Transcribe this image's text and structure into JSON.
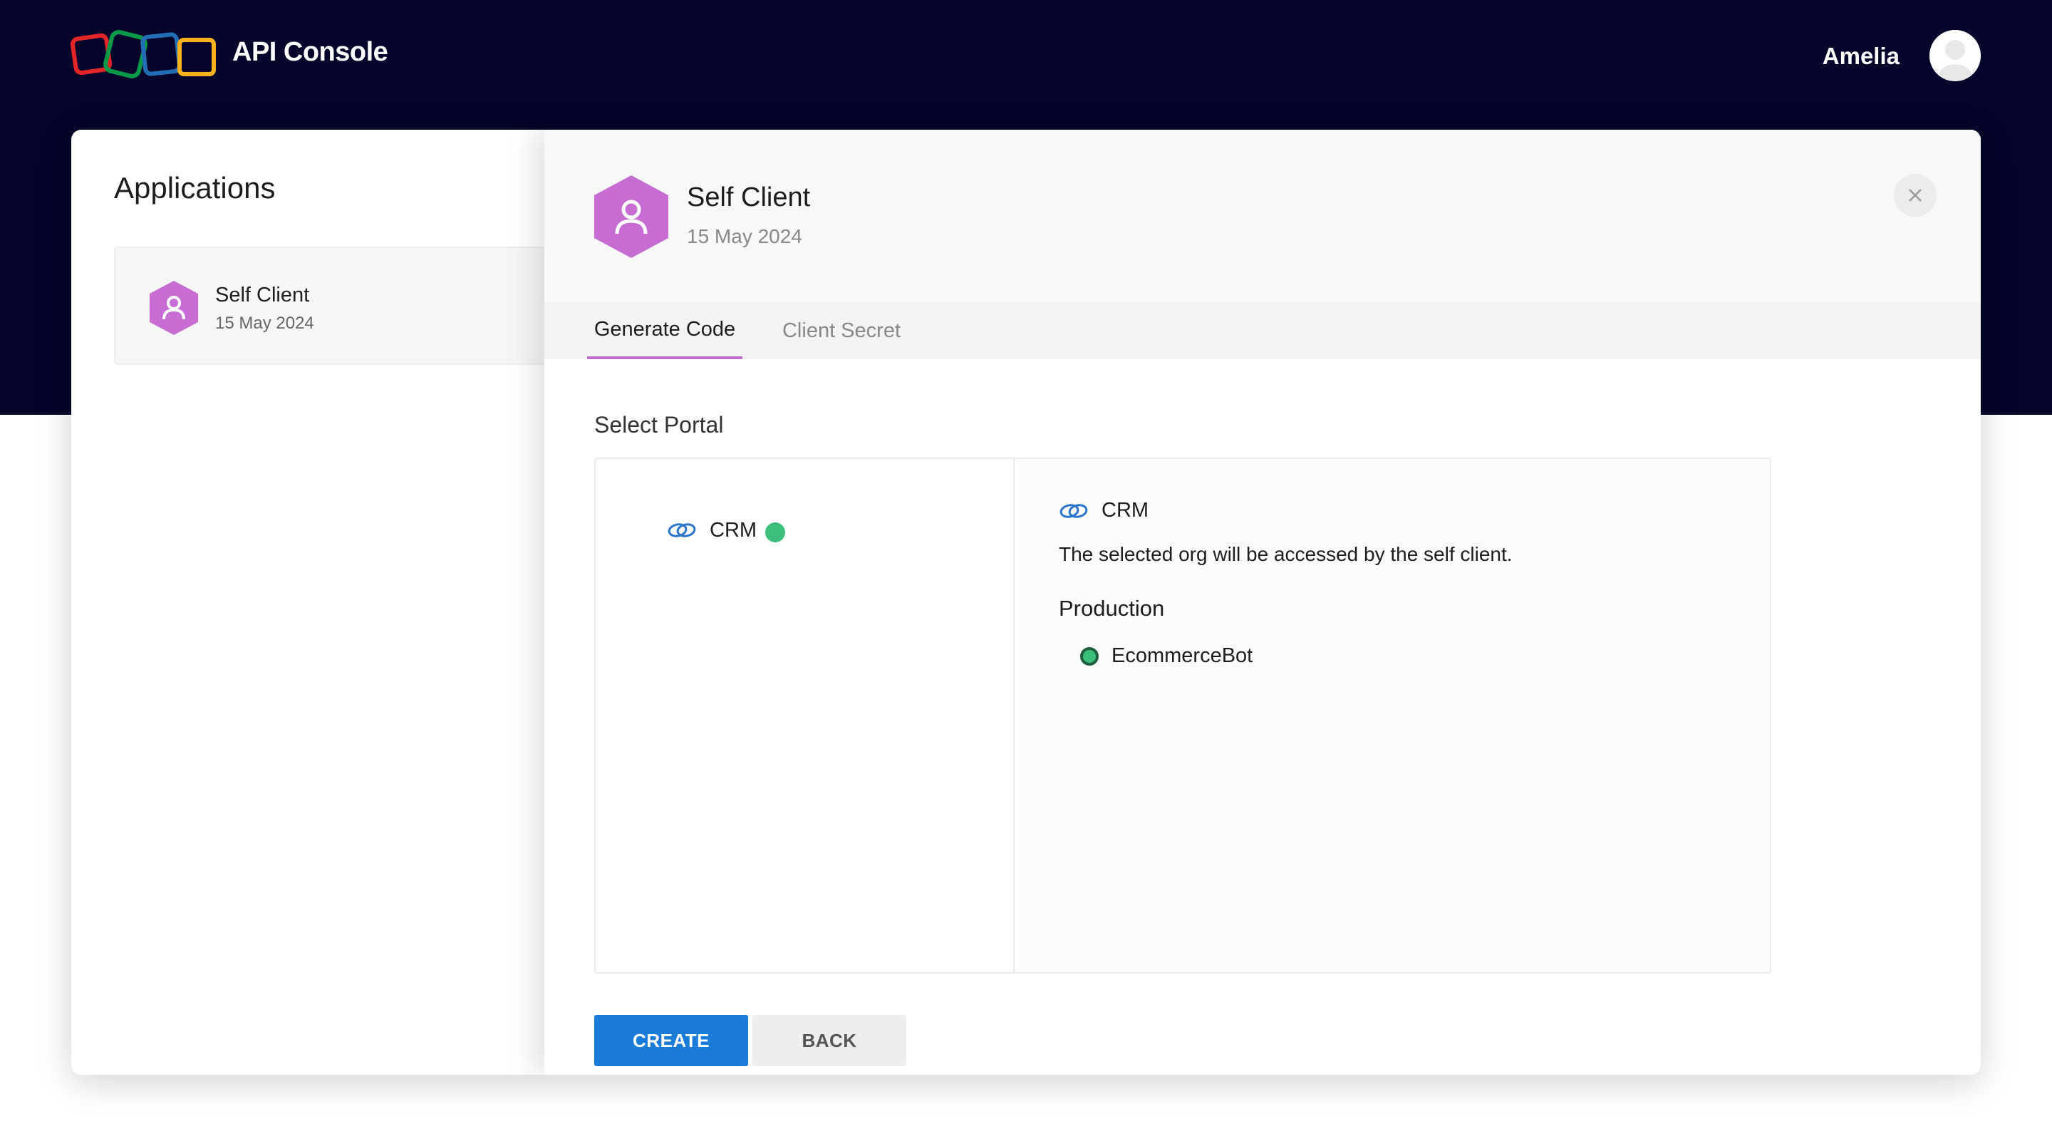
{
  "header": {
    "app_title": "API Console",
    "user_name": "Amelia"
  },
  "applications": {
    "title": "Applications",
    "items": [
      {
        "name": "Self Client",
        "date": "15 May 2024"
      }
    ]
  },
  "detail": {
    "name": "Self Client",
    "date": "15 May 2024",
    "tabs": [
      {
        "label": "Generate Code",
        "active": true
      },
      {
        "label": "Client Secret",
        "active": false
      }
    ],
    "section_label": "Select Portal",
    "portals": [
      {
        "label": "CRM",
        "status_color": "#3bbf7a"
      }
    ],
    "selected_portal": {
      "label": "CRM",
      "description": "The selected org will be accessed by the self client.",
      "environment": "Production",
      "orgs": [
        {
          "label": "EcommerceBot",
          "selected": true
        }
      ]
    },
    "buttons": {
      "create": "CREATE",
      "back": "BACK"
    }
  },
  "colors": {
    "top_band": "#05052b",
    "accent_purple": "#c26ad0",
    "primary_blue": "#1a7bd9",
    "status_green": "#3bbf7a"
  },
  "icons": {
    "logo": "zoho-logo-icon",
    "avatar": "user-avatar-icon",
    "app": "user-hexagon-icon",
    "close": "close-icon",
    "portal": "crm-link-icon"
  }
}
